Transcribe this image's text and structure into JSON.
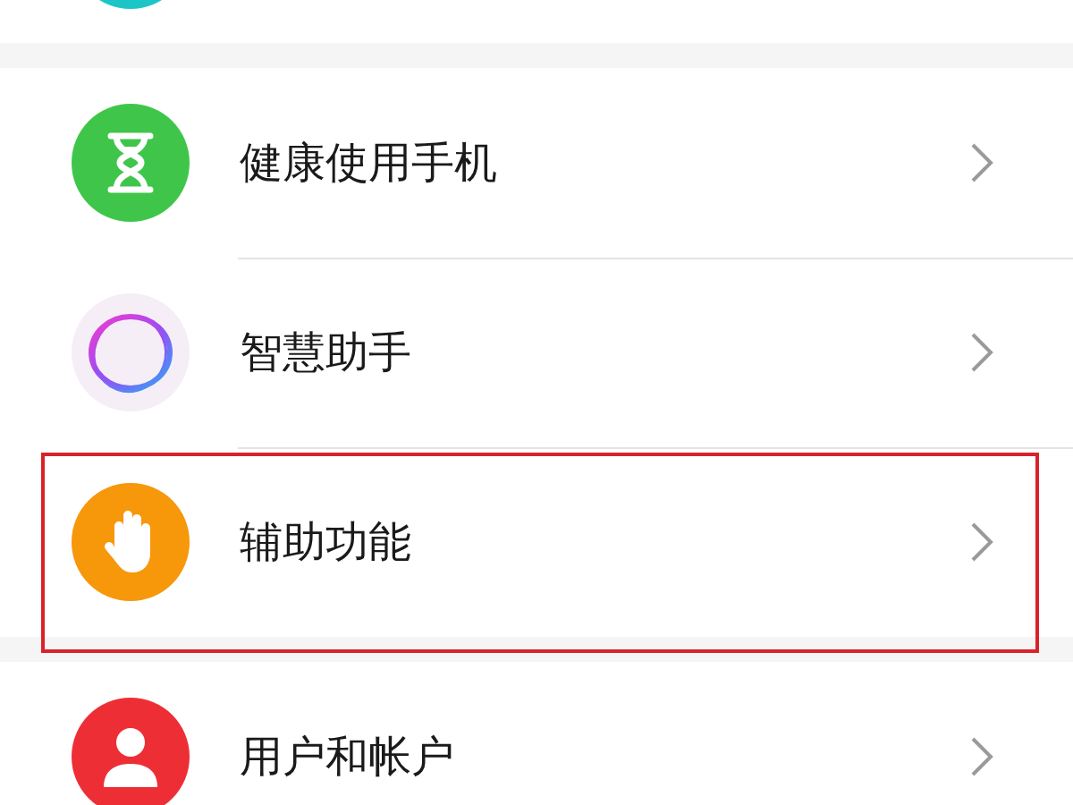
{
  "top_item": {
    "kind": "teal"
  },
  "sections": [
    {
      "items": [
        {
          "kind": "hourglass",
          "label": "健康使用手机",
          "highlighted": false
        },
        {
          "kind": "assistant",
          "label": "智慧助手",
          "highlighted": false
        },
        {
          "kind": "hand",
          "label": "辅助功能",
          "highlighted": true
        }
      ]
    },
    {
      "items": [
        {
          "kind": "user",
          "label": "用户和帐户",
          "highlighted": false
        }
      ]
    }
  ]
}
